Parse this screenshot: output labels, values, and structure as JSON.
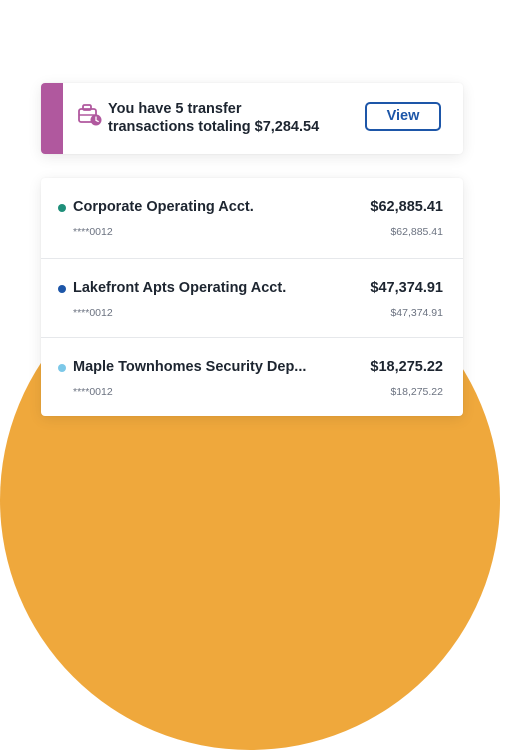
{
  "colors": {
    "background_circle": "#efa83c",
    "notice_accent": "#b0589e",
    "button_blue": "#1d56a8",
    "dot_green": "#1f8f7a",
    "dot_blue": "#1d56a8",
    "dot_light_blue": "#7cc8e8"
  },
  "notice": {
    "icon": "briefcase-clock-icon",
    "line1": "You have 5 transfer",
    "line2": "transactions totaling $7,284.54",
    "button_label": "View"
  },
  "accounts": [
    {
      "name": "Corporate Operating Acct.",
      "masked_number": "****0012",
      "balance": "$62,885.41",
      "available": "$62,885.41",
      "dot_color": "#1f8f7a"
    },
    {
      "name": "Lakefront Apts Operating Acct.",
      "masked_number": "****0012",
      "balance": "$47,374.91",
      "available": "$47,374.91",
      "dot_color": "#1d56a8"
    },
    {
      "name": "Maple Townhomes Security Dep...",
      "masked_number": "****0012",
      "balance": "$18,275.22",
      "available": "$18,275.22",
      "dot_color": "#7cc8e8"
    }
  ]
}
